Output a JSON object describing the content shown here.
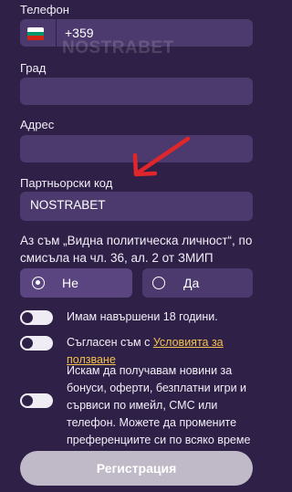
{
  "phone": {
    "label": "Телефон",
    "country_code": "+359",
    "flag_colors": [
      "#ffffff",
      "#00966e",
      "#d62612"
    ],
    "flag_icon": "bulgaria-flag-icon"
  },
  "watermark": "NOSTRABET",
  "city": {
    "label": "Град",
    "value": ""
  },
  "address": {
    "label": "Адрес",
    "value": ""
  },
  "partner_code": {
    "label": "Партньорски код",
    "value": "NOSTRABET"
  },
  "annotation": {
    "icon": "red-arrow-icon",
    "color": "#e0262a"
  },
  "pep": {
    "question": "Аз съм „Видна политическа личност“, по смисъла на чл. 36, ал. 2 от ЗМИП",
    "option_no": "Не",
    "option_yes": "Да",
    "selected": "Не"
  },
  "consents": {
    "age": "Имам навършени 18 години.",
    "terms_prefix": "Съгласен съм с ",
    "terms_link": "Условията за ползване",
    "marketing": "Искам да получавам новини за бонуси, оферти, безплатни игри и сървиси по имейл, СМС или телефон. Можете да промените преференциите си по всяко време"
  },
  "submit_label": "Регистрация",
  "colors": {
    "background": "#2f2047",
    "field": "#4c3a6e",
    "selected_radio": "#5a4580",
    "link": "#f2c14e",
    "button": "#bfb9c8"
  }
}
